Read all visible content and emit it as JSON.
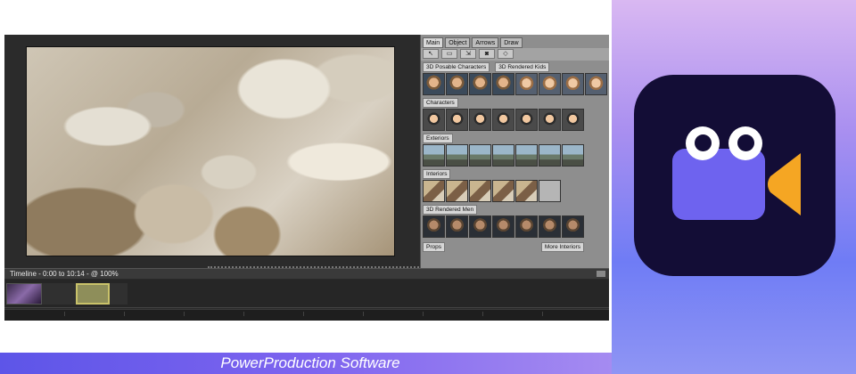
{
  "footer": {
    "caption": "PowerProduction Software"
  },
  "app": {
    "tabs": [
      "Main",
      "Object",
      "Arrows",
      "Draw"
    ],
    "library": {
      "posable_header": "3D Posable Characters",
      "kids_header": "3D Rendered Kids",
      "characters_header": "Characters",
      "exteriors_header": "Exteriors",
      "interiors_header": "Interiors",
      "men_header": "3D Rendered Men",
      "props_button": "Props",
      "more_interiors_button": "More Interiors"
    },
    "timeline": {
      "label": "Timeline - 0:00 to 10:14 - @ 100%"
    }
  },
  "icon": {
    "name": "camera-app-icon",
    "background": "#130d36",
    "body": "#6e63ef",
    "lens": "#f5a623"
  }
}
